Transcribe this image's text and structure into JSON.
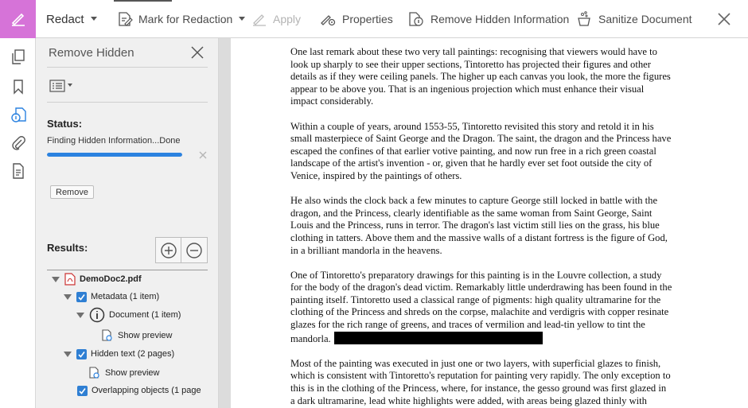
{
  "toolbar": {
    "redact_label": "Redact",
    "mark_label": "Mark for Redaction",
    "apply_label": "Apply",
    "properties_label": "Properties",
    "remove_hidden_label": "Remove Hidden Information",
    "sanitize_label": "Sanitize Document",
    "badge_color": "#d673d8"
  },
  "rail": {
    "icons": [
      "pages-icon",
      "bookmark-icon",
      "remove-hidden-icon",
      "attachment-icon",
      "document-icon"
    ]
  },
  "panel": {
    "title": "Remove Hidden",
    "status_label": "Status:",
    "status_text": "Finding Hidden Information...Done",
    "progress_fraction": 1.0,
    "progress_color": "#2b82e0",
    "remove_label": "Remove",
    "results_label": "Results:",
    "tree": {
      "file": "DemoDoc2.pdf",
      "metadata": "Metadata (1 item)",
      "document": "Document (1 item)",
      "show_preview": "Show preview",
      "hidden_text": "Hidden text (2 pages)",
      "show_preview_2": "Show preview",
      "overlapping": "Overlapping objects (1 page"
    }
  },
  "document": {
    "paragraphs": [
      "One last remark about these two very tall paintings: recognising that viewers would have to look up sharply to see their upper sections, Tintoretto has projected their figures and other details as if they were ceiling panels. The higher up each canvas you look, the more the figures appear to be above you. That is an ingenious projection which must enhance their visual impact considerably.",
      "Within a couple of years, around 1553-55, Tintoretto revisited this story and retold it in his small masterpiece of Saint George and the Dragon. The saint, the dragon and the Princess have escaped the confines of that earlier votive painting, and now run free in a rich green coastal landscape of the artist's invention - or, given that he hardly ever set foot outside the city of Venice, inspired by the paintings of others.",
      "He also winds the clock back a few minutes to capture George still locked in battle with the dragon, and the Princess, clearly identifiable as the same woman from Saint George, Saint Louis and the Princess, runs in terror. The dragon's last victim still lies on the grass, his blue clothing in tatters. Above them and the massive walls of a distant fortress is the figure of God, in a brilliant mandorla in the heavens.",
      "One of Tintoretto's preparatory drawings for this painting is in the Louvre collection, a study for the body of the dragon's dead victim. Remarkably little underdrawing has been found in the painting itself. Tintoretto used a classical range of pigments: high quality ultramarine for the clothing of the Princess and shreds on the corpse, malachite and verdigris with copper resinate glazes for the rich range of greens, and traces of vermilion and lead-tin yellow to tint the mandorla.",
      "Most of the painting was executed in just one or two layers, with superficial glazes to finish, which is consistent with Tintoretto's reputation for painting very rapidly. The only exception to this is in the clothing of the Princess, where, for instance, the gesso ground was first glazed in a dark ultramarine, lead white highlights were added, with areas being glazed thinly with"
    ]
  }
}
